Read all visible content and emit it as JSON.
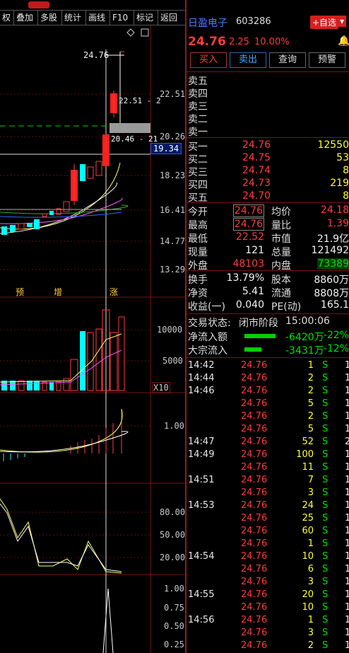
{
  "toolbar": {
    "items": [
      "权",
      "叠加",
      "多股",
      "统计",
      "画线",
      "F10",
      "标记",
      "返回"
    ]
  },
  "chart": {
    "price_axis": [
      "22.51",
      "20.26",
      "18.23",
      "16.41",
      "14.77",
      "13.29"
    ],
    "current_price_tag": "19.34",
    "top_label": "24.76",
    "annot_upper": "22.51 - 2",
    "annot_lower": "20.46 - 21",
    "events": [
      "预",
      "增",
      "涨"
    ],
    "vol_axis": [
      "10000",
      "5000"
    ],
    "vol_unit": "X10",
    "ind1_axis": [
      "1.00"
    ],
    "ind2_axis": [
      "80.00",
      "50.00",
      "20.00"
    ],
    "ind3_axis": [
      "1.00",
      "0.75",
      "0.50",
      "0.25"
    ]
  },
  "stock": {
    "name": "日盈电子",
    "code": "603286",
    "add_btn": "+自选",
    "price": "24.76",
    "change": "2.25",
    "pct": "10.00%"
  },
  "actions": [
    "买入",
    "卖出",
    "查询",
    "预警"
  ],
  "sell": [
    "卖五",
    "卖四",
    "卖三",
    "卖二",
    "卖一"
  ],
  "buy": [
    {
      "l": "买一",
      "p": "24.76",
      "v": "12550"
    },
    {
      "l": "买二",
      "p": "24.75",
      "v": "53"
    },
    {
      "l": "买三",
      "p": "24.74",
      "v": "8"
    },
    {
      "l": "买四",
      "p": "24.73",
      "v": "219"
    },
    {
      "l": "买五",
      "p": "24.70",
      "v": "8"
    }
  ],
  "stats": [
    {
      "a": "今开",
      "b": "24.76",
      "c": "均价",
      "d": "24.18"
    },
    {
      "a": "最高",
      "b": "24.76",
      "c": "量比",
      "d": "1.39"
    },
    {
      "a": "最低",
      "b": "22.52",
      "c": "市值",
      "d": "21.9亿"
    },
    {
      "a": "现量",
      "b": "121",
      "c": "总量",
      "d": "121492"
    },
    {
      "a": "外盘",
      "b": "48103",
      "c": "内盘",
      "d": "73389"
    }
  ],
  "stats2": [
    {
      "a": "换手",
      "b": "13.79%",
      "c": "股本",
      "d": "8860万"
    },
    {
      "a": "净资",
      "b": "5.41",
      "c": "流通",
      "d": "8808万"
    },
    {
      "a": "收益(一)",
      "b": "0.040",
      "c": "PE(动)",
      "d": "165.1"
    }
  ],
  "status": {
    "label": "交易状态:",
    "value": "闭市阶段",
    "time": "15:00:06"
  },
  "flows": [
    {
      "label": "净流入额",
      "value": "-6420万",
      "pct": "-22%",
      "frac": 0.22
    },
    {
      "label": "大宗流入",
      "value": "-3431万",
      "pct": "-12%",
      "frac": 0.12
    }
  ],
  "trades": [
    {
      "t": "14:42",
      "p": "24.76",
      "v": "1",
      "s": "S",
      "x": "1"
    },
    {
      "t": "14:44",
      "p": "24.76",
      "v": "2",
      "s": "S",
      "x": "1"
    },
    {
      "t": "14:46",
      "p": "24.76",
      "v": "2",
      "s": "S",
      "x": "1"
    },
    {
      "t": "",
      "p": "24.76",
      "v": "5",
      "s": "S",
      "x": "1"
    },
    {
      "t": "",
      "p": "24.76",
      "v": "2",
      "s": "S",
      "x": "1"
    },
    {
      "t": "",
      "p": "24.76",
      "v": "5",
      "s": "S",
      "x": "1"
    },
    {
      "t": "14:47",
      "p": "24.76",
      "v": "52",
      "s": "S",
      "x": "2"
    },
    {
      "t": "14:49",
      "p": "24.76",
      "v": "100",
      "s": "S",
      "x": "1"
    },
    {
      "t": "",
      "p": "24.76",
      "v": "11",
      "s": "S",
      "x": "1"
    },
    {
      "t": "14:51",
      "p": "24.76",
      "v": "7",
      "s": "S",
      "x": "1"
    },
    {
      "t": "",
      "p": "24.76",
      "v": "3",
      "s": "S",
      "x": "1"
    },
    {
      "t": "14:53",
      "p": "24.76",
      "v": "24",
      "s": "S",
      "x": "1"
    },
    {
      "t": "",
      "p": "24.76",
      "v": "25",
      "s": "S",
      "x": "1"
    },
    {
      "t": "",
      "p": "24.76",
      "v": "60",
      "s": "S",
      "x": "1"
    },
    {
      "t": "",
      "p": "24.76",
      "v": "1",
      "s": "S",
      "x": "1"
    },
    {
      "t": "14:54",
      "p": "24.76",
      "v": "10",
      "s": "S",
      "x": "1"
    },
    {
      "t": "",
      "p": "24.76",
      "v": "6",
      "s": "S",
      "x": "1"
    },
    {
      "t": "",
      "p": "24.76",
      "v": "3",
      "s": "S",
      "x": "1"
    },
    {
      "t": "14:55",
      "p": "24.76",
      "v": "20",
      "s": "S",
      "x": "1"
    },
    {
      "t": "",
      "p": "24.76",
      "v": "10",
      "s": "S",
      "x": "1"
    },
    {
      "t": "14:56",
      "p": "24.76",
      "v": "1",
      "s": "S",
      "x": "1"
    },
    {
      "t": "",
      "p": "24.76",
      "v": "3",
      "s": "S",
      "x": "1"
    },
    {
      "t": "",
      "p": "24.76",
      "v": "2",
      "s": "S",
      "x": "1"
    }
  ],
  "colors": {
    "up": "#ff3b3b",
    "down": "#00ffff",
    "accent": "#ffff33",
    "border": "#7a1414"
  }
}
